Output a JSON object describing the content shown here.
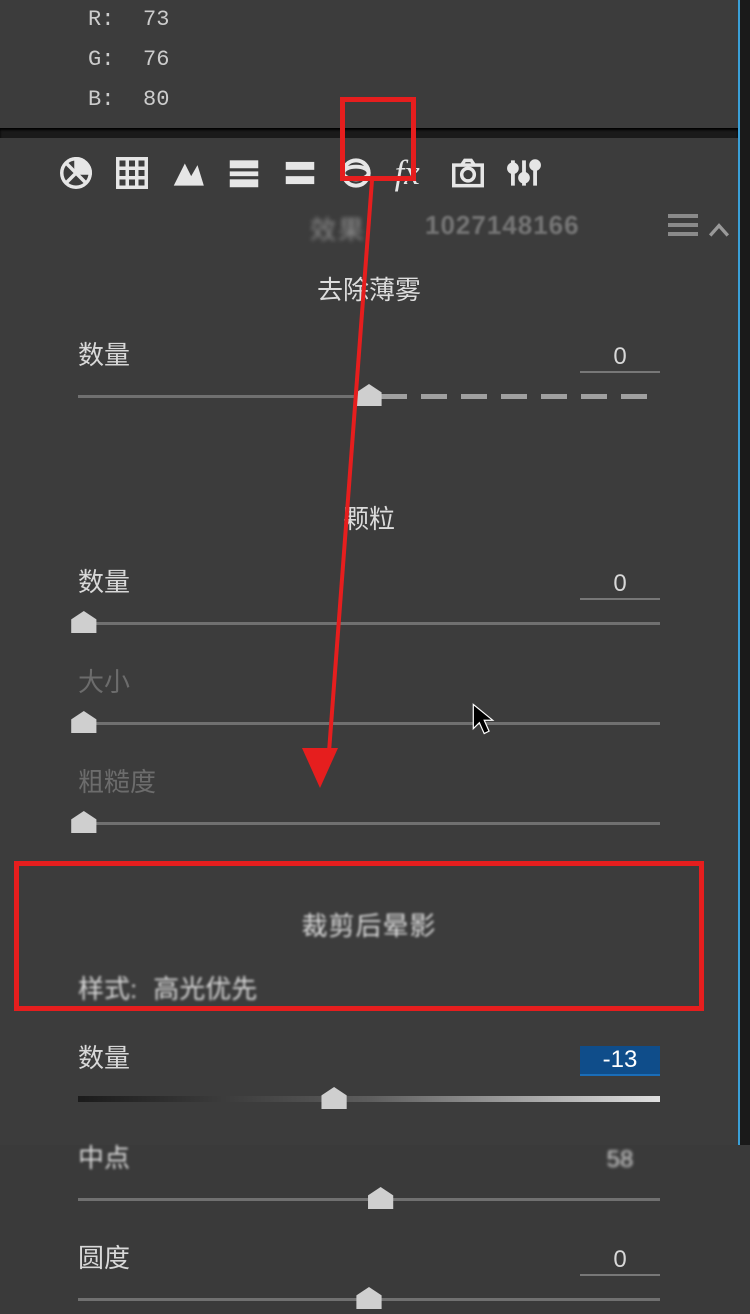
{
  "rgb": {
    "r_label": "R:",
    "g_label": "G:",
    "b_label": "B:",
    "r": "73",
    "g": "76",
    "b": "80"
  },
  "toolbar": {
    "title": "效果",
    "watermark": "1027148166"
  },
  "dehaze": {
    "title": "去除薄雾",
    "amount_label": "数量",
    "amount_value": "0",
    "thumb_pct": 50
  },
  "grain": {
    "title": "颗粒",
    "amount_label": "数量",
    "amount_value": "0",
    "amount_thumb_pct": 1,
    "size_label": "大小",
    "size_thumb_pct": 1,
    "roughness_label": "粗糙度",
    "roughness_thumb_pct": 1
  },
  "vignette": {
    "title": "裁剪后晕影",
    "style_label": "样式:",
    "style_value": "高光优先",
    "amount_label": "数量",
    "amount_value": "-13",
    "amount_thumb_pct": 44,
    "midpoint_label": "中点",
    "midpoint_value": "58",
    "midpoint_thumb_pct": 52,
    "roundness_label": "圆度",
    "roundness_value": "0",
    "roundness_thumb_pct": 50
  }
}
